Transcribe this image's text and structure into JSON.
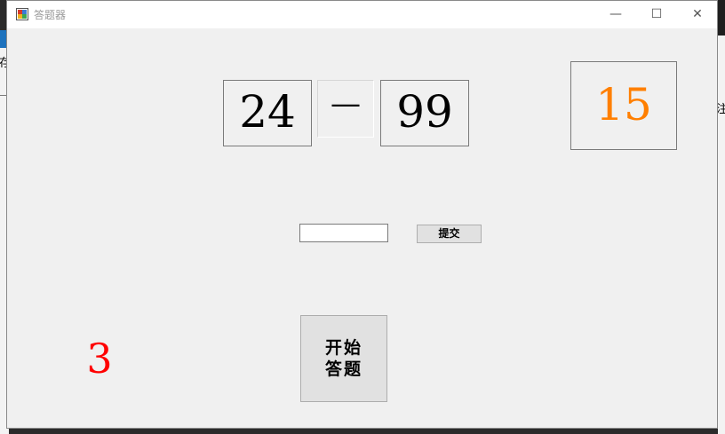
{
  "window": {
    "title": "答题器",
    "controls": {
      "minimize": "—",
      "maximize": "☐",
      "close": "✕"
    }
  },
  "background": {
    "left_text": "存",
    "right_text": "注"
  },
  "quiz": {
    "operand1": "24",
    "operator": "—",
    "operand2": "99",
    "timer": "15",
    "answer_value": "",
    "submit_label": "提交",
    "start_label": "开始答题",
    "score": "3"
  },
  "colors": {
    "timer": "#ff7f00",
    "score": "#ff0000"
  }
}
